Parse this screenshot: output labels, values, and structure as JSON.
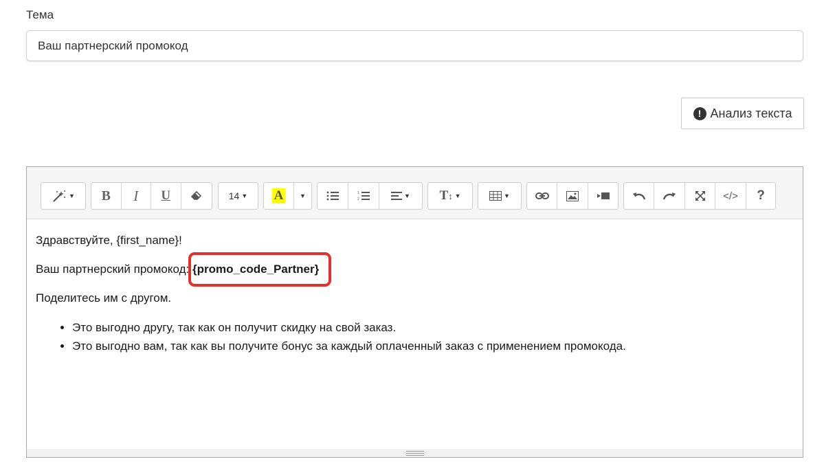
{
  "subject": {
    "label": "Тема",
    "value": "Ваш партнерский промокод"
  },
  "analyze_button": {
    "label": "Анализ текста",
    "icon": "exclamation-circle-icon"
  },
  "toolbar": {
    "font_size": "14",
    "help_label": "?",
    "bold_label": "B",
    "italic_label": "I",
    "underline_label": "U",
    "highlight_label": "A",
    "highlight_color": "#ffff00",
    "textsize_label": "T",
    "code_label": "</>"
  },
  "content": {
    "greeting": "Здравствуйте, {first_name}!",
    "promo_prefix": "Ваш партнерский промокод: ",
    "promo_code": "{promo_code_Partner}",
    "share": "Поделитесь им с другом.",
    "bullets": [
      "Это выгодно другу, так как он получит скидку на свой заказ.",
      "Это выгодно вам, так как вы получите бонус за каждый оплаченный заказ с применением промокода."
    ]
  },
  "colors": {
    "highlight_box": "#e0322a"
  }
}
